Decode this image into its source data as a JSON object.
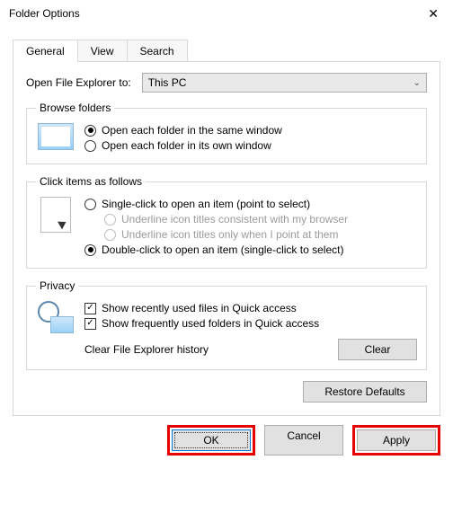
{
  "window": {
    "title": "Folder Options"
  },
  "tabs": {
    "general": "General",
    "view": "View",
    "search": "Search"
  },
  "open_to": {
    "label": "Open File Explorer to:",
    "value": "This PC"
  },
  "browse": {
    "legend": "Browse folders",
    "opt_same": "Open each folder in the same window",
    "opt_own": "Open each folder in its own window"
  },
  "click": {
    "legend": "Click items as follows",
    "single": "Single-click to open an item (point to select)",
    "underline_browser": "Underline icon titles consistent with my browser",
    "underline_point": "Underline icon titles only when I point at them",
    "double": "Double-click to open an item (single-click to select)"
  },
  "privacy": {
    "legend": "Privacy",
    "recent_files": "Show recently used files in Quick access",
    "frequent_folders": "Show frequently used folders in Quick access",
    "clear_label": "Clear File Explorer history",
    "clear_btn": "Clear"
  },
  "buttons": {
    "restore": "Restore Defaults",
    "ok": "OK",
    "cancel": "Cancel",
    "apply": "Apply"
  }
}
